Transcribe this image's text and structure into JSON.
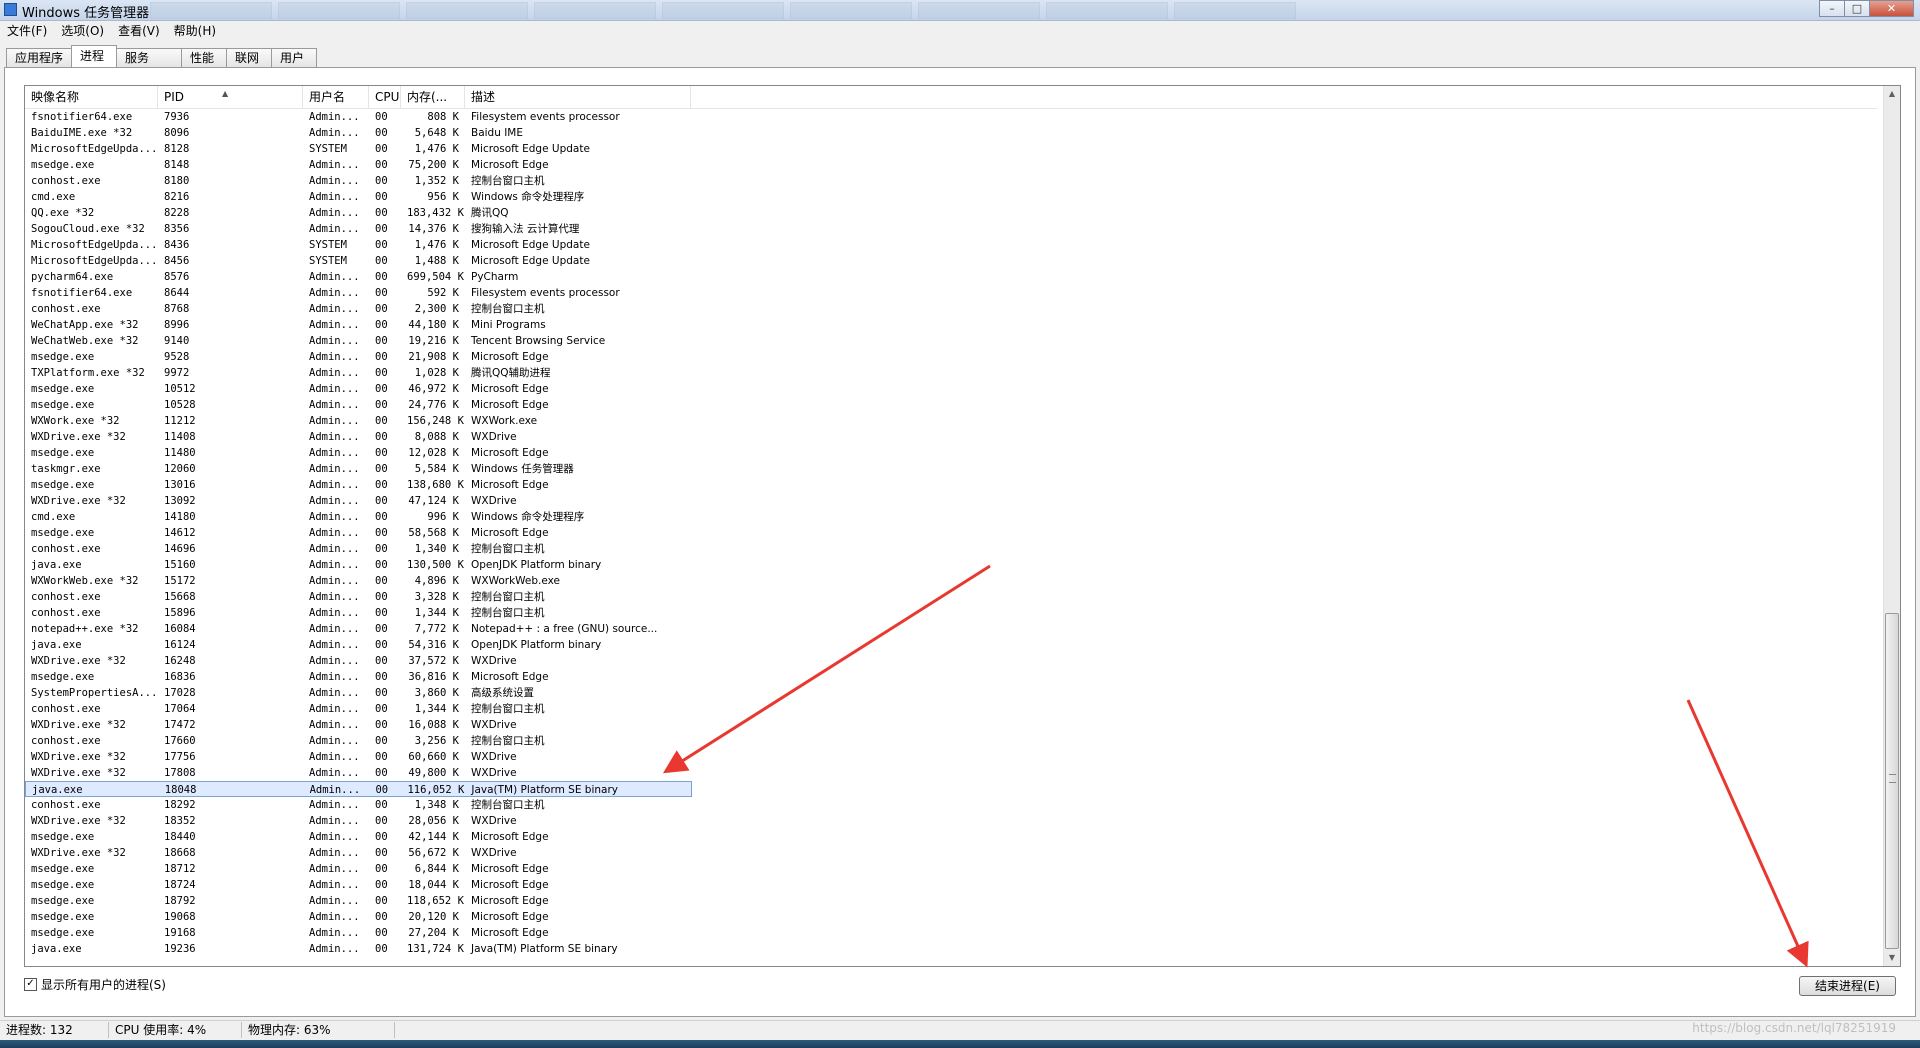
{
  "window": {
    "title": "Windows 任务管理器"
  },
  "menu": [
    "文件(F)",
    "选项(O)",
    "查看(V)",
    "帮助(H)"
  ],
  "tabs": [
    "应用程序",
    "进程",
    "服务",
    "性能",
    "联网",
    "用户"
  ],
  "active_tab": 1,
  "columns": [
    "映像名称",
    "PID",
    "用户名",
    "CPU",
    "内存(...",
    "描述"
  ],
  "processes": [
    [
      "fsnotifier64.exe",
      "7936",
      "Admin...",
      "00",
      "808 K",
      "Filesystem events processor"
    ],
    [
      "BaiduIME.exe *32",
      "8096",
      "Admin...",
      "00",
      "5,648 K",
      "Baidu IME"
    ],
    [
      "MicrosoftEdgeUpda...",
      "8128",
      "SYSTEM",
      "00",
      "1,476 K",
      "Microsoft Edge Update"
    ],
    [
      "msedge.exe",
      "8148",
      "Admin...",
      "00",
      "75,200 K",
      "Microsoft Edge"
    ],
    [
      "conhost.exe",
      "8180",
      "Admin...",
      "00",
      "1,352 K",
      "控制台窗口主机"
    ],
    [
      "cmd.exe",
      "8216",
      "Admin...",
      "00",
      "956 K",
      "Windows 命令处理程序"
    ],
    [
      "QQ.exe *32",
      "8228",
      "Admin...",
      "00",
      "183,432 K",
      "腾讯QQ"
    ],
    [
      "SogouCloud.exe *32",
      "8356",
      "Admin...",
      "00",
      "14,376 K",
      "搜狗输入法 云计算代理"
    ],
    [
      "MicrosoftEdgeUpda...",
      "8436",
      "SYSTEM",
      "00",
      "1,476 K",
      "Microsoft Edge Update"
    ],
    [
      "MicrosoftEdgeUpda...",
      "8456",
      "SYSTEM",
      "00",
      "1,488 K",
      "Microsoft Edge Update"
    ],
    [
      "pycharm64.exe",
      "8576",
      "Admin...",
      "00",
      "699,504 K",
      "PyCharm"
    ],
    [
      "fsnotifier64.exe",
      "8644",
      "Admin...",
      "00",
      "592 K",
      "Filesystem events processor"
    ],
    [
      "conhost.exe",
      "8768",
      "Admin...",
      "00",
      "2,300 K",
      "控制台窗口主机"
    ],
    [
      "WeChatApp.exe *32",
      "8996",
      "Admin...",
      "00",
      "44,180 K",
      "Mini Programs"
    ],
    [
      "WeChatWeb.exe *32",
      "9140",
      "Admin...",
      "00",
      "19,216 K",
      "Tencent Browsing Service"
    ],
    [
      "msedge.exe",
      "9528",
      "Admin...",
      "00",
      "21,908 K",
      "Microsoft Edge"
    ],
    [
      "TXPlatform.exe *32",
      "9972",
      "Admin...",
      "00",
      "1,028 K",
      "腾讯QQ辅助进程"
    ],
    [
      "msedge.exe",
      "10512",
      "Admin...",
      "00",
      "46,972 K",
      "Microsoft Edge"
    ],
    [
      "msedge.exe",
      "10528",
      "Admin...",
      "00",
      "24,776 K",
      "Microsoft Edge"
    ],
    [
      "WXWork.exe *32",
      "11212",
      "Admin...",
      "00",
      "156,248 K",
      "WXWork.exe"
    ],
    [
      "WXDrive.exe *32",
      "11408",
      "Admin...",
      "00",
      "8,088 K",
      "WXDrive"
    ],
    [
      "msedge.exe",
      "11480",
      "Admin...",
      "00",
      "12,028 K",
      "Microsoft Edge"
    ],
    [
      "taskmgr.exe",
      "12060",
      "Admin...",
      "00",
      "5,584 K",
      "Windows 任务管理器"
    ],
    [
      "msedge.exe",
      "13016",
      "Admin...",
      "00",
      "138,680 K",
      "Microsoft Edge"
    ],
    [
      "WXDrive.exe *32",
      "13092",
      "Admin...",
      "00",
      "47,124 K",
      "WXDrive"
    ],
    [
      "cmd.exe",
      "14180",
      "Admin...",
      "00",
      "996 K",
      "Windows 命令处理程序"
    ],
    [
      "msedge.exe",
      "14612",
      "Admin...",
      "00",
      "58,568 K",
      "Microsoft Edge"
    ],
    [
      "conhost.exe",
      "14696",
      "Admin...",
      "00",
      "1,340 K",
      "控制台窗口主机"
    ],
    [
      "java.exe",
      "15160",
      "Admin...",
      "00",
      "130,500 K",
      "OpenJDK Platform binary"
    ],
    [
      "WXWorkWeb.exe *32",
      "15172",
      "Admin...",
      "00",
      "4,896 K",
      "WXWorkWeb.exe"
    ],
    [
      "conhost.exe",
      "15668",
      "Admin...",
      "00",
      "3,328 K",
      "控制台窗口主机"
    ],
    [
      "conhost.exe",
      "15896",
      "Admin...",
      "00",
      "1,344 K",
      "控制台窗口主机"
    ],
    [
      "notepad++.exe *32",
      "16084",
      "Admin...",
      "00",
      "7,772 K",
      "Notepad++ : a free (GNU) source..."
    ],
    [
      "java.exe",
      "16124",
      "Admin...",
      "00",
      "54,316 K",
      "OpenJDK Platform binary"
    ],
    [
      "WXDrive.exe *32",
      "16248",
      "Admin...",
      "00",
      "37,572 K",
      "WXDrive"
    ],
    [
      "msedge.exe",
      "16836",
      "Admin...",
      "00",
      "36,816 K",
      "Microsoft Edge"
    ],
    [
      "SystemPropertiesA...",
      "17028",
      "Admin...",
      "00",
      "3,860 K",
      "高级系统设置"
    ],
    [
      "conhost.exe",
      "17064",
      "Admin...",
      "00",
      "1,344 K",
      "控制台窗口主机"
    ],
    [
      "WXDrive.exe *32",
      "17472",
      "Admin...",
      "00",
      "16,088 K",
      "WXDrive"
    ],
    [
      "conhost.exe",
      "17660",
      "Admin...",
      "00",
      "3,256 K",
      "控制台窗口主机"
    ],
    [
      "WXDrive.exe *32",
      "17756",
      "Admin...",
      "00",
      "60,660 K",
      "WXDrive"
    ],
    [
      "WXDrive.exe *32",
      "17808",
      "Admin...",
      "00",
      "49,800 K",
      "WXDrive"
    ],
    [
      "java.exe",
      "18048",
      "Admin...",
      "00",
      "116,052 K",
      "Java(TM) Platform SE binary"
    ],
    [
      "conhost.exe",
      "18292",
      "Admin...",
      "00",
      "1,348 K",
      "控制台窗口主机"
    ],
    [
      "WXDrive.exe *32",
      "18352",
      "Admin...",
      "00",
      "28,056 K",
      "WXDrive"
    ],
    [
      "msedge.exe",
      "18440",
      "Admin...",
      "00",
      "42,144 K",
      "Microsoft Edge"
    ],
    [
      "WXDrive.exe *32",
      "18668",
      "Admin...",
      "00",
      "56,672 K",
      "WXDrive"
    ],
    [
      "msedge.exe",
      "18712",
      "Admin...",
      "00",
      "6,844 K",
      "Microsoft Edge"
    ],
    [
      "msedge.exe",
      "18724",
      "Admin...",
      "00",
      "18,044 K",
      "Microsoft Edge"
    ],
    [
      "msedge.exe",
      "18792",
      "Admin...",
      "00",
      "118,652 K",
      "Microsoft Edge"
    ],
    [
      "msedge.exe",
      "19068",
      "Admin...",
      "00",
      "20,120 K",
      "Microsoft Edge"
    ],
    [
      "msedge.exe",
      "19168",
      "Admin...",
      "00",
      "27,204 K",
      "Microsoft Edge"
    ],
    [
      "java.exe",
      "19236",
      "Admin...",
      "00",
      "131,724 K",
      "Java(TM) Platform SE binary"
    ]
  ],
  "selected_pid": "18048",
  "show_all_label": "显示所有用户的进程(S)",
  "show_all_checked": true,
  "end_process_label": "结束进程(E)",
  "status": {
    "process_count": "进程数: 132",
    "cpu_usage": "CPU 使用率: 4%",
    "memory": "物理内存: 63%"
  },
  "watermark": "https://blog.csdn.net/lql78251919",
  "accent_color": "#e8382f"
}
